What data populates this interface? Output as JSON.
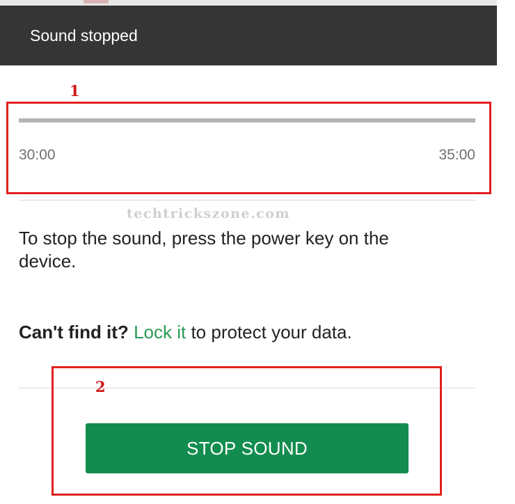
{
  "header": {
    "title": "Sound stopped"
  },
  "annotations": {
    "label_1": "1",
    "label_2": "2",
    "color": "#e02020"
  },
  "timer": {
    "start": "30:00",
    "end": "35:00"
  },
  "watermark": "techtrickszone.com",
  "instructions": "To stop the sound, press the power key on the device.",
  "lock_message": {
    "prefix": "Can't find it?",
    "link": "Lock it",
    "suffix": "to protect your data."
  },
  "action": {
    "stop_sound_label": "STOP SOUND"
  },
  "colors": {
    "header_bg": "#353535",
    "accent_green": "#138d4f",
    "link_green": "#2a9a53"
  }
}
